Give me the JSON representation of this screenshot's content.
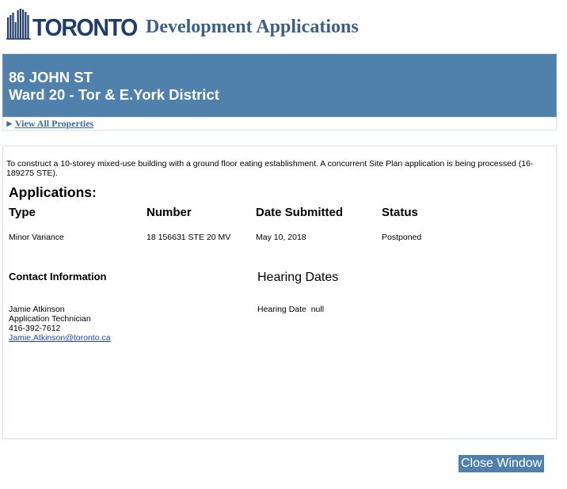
{
  "header": {
    "logo_text": "TORONTO",
    "app_title": "Development Applications"
  },
  "banner": {
    "address": "86 JOHN ST",
    "ward": "Ward 20 - Tor & E.York District"
  },
  "nav": {
    "view_all_arrow": "►",
    "view_all_label": "View All Properties"
  },
  "main": {
    "description": "To construct a 10-storey mixed-use building with a ground floor eating establishment. A concurrent Site Plan application is being processed (16-189275 STE).",
    "applications_heading": "Applications:",
    "columns": {
      "type": "Type",
      "number": "Number",
      "date_submitted": "Date Submitted",
      "status": "Status"
    },
    "rows": [
      {
        "type": "Minor Variance",
        "number": "18 156631 STE 20 MV",
        "date_submitted": "May 10, 2018",
        "status": "Postponed"
      }
    ],
    "contact": {
      "heading": "Contact Information",
      "name": "Jamie Atkinson",
      "title": "Application Technician",
      "phone": "416-392-7612",
      "email": "Jamie.Atkinson@toronto.ca"
    },
    "hearing": {
      "heading": "Hearing Dates",
      "line": "Hearing Date  null"
    }
  },
  "footer": {
    "close_label": "Close Window"
  },
  "colors": {
    "banner_blue": "#5081ac",
    "title_blue": "#3c5f8a",
    "logo_navy": "#1f3d6b",
    "link_blue": "#1a3fbf"
  }
}
